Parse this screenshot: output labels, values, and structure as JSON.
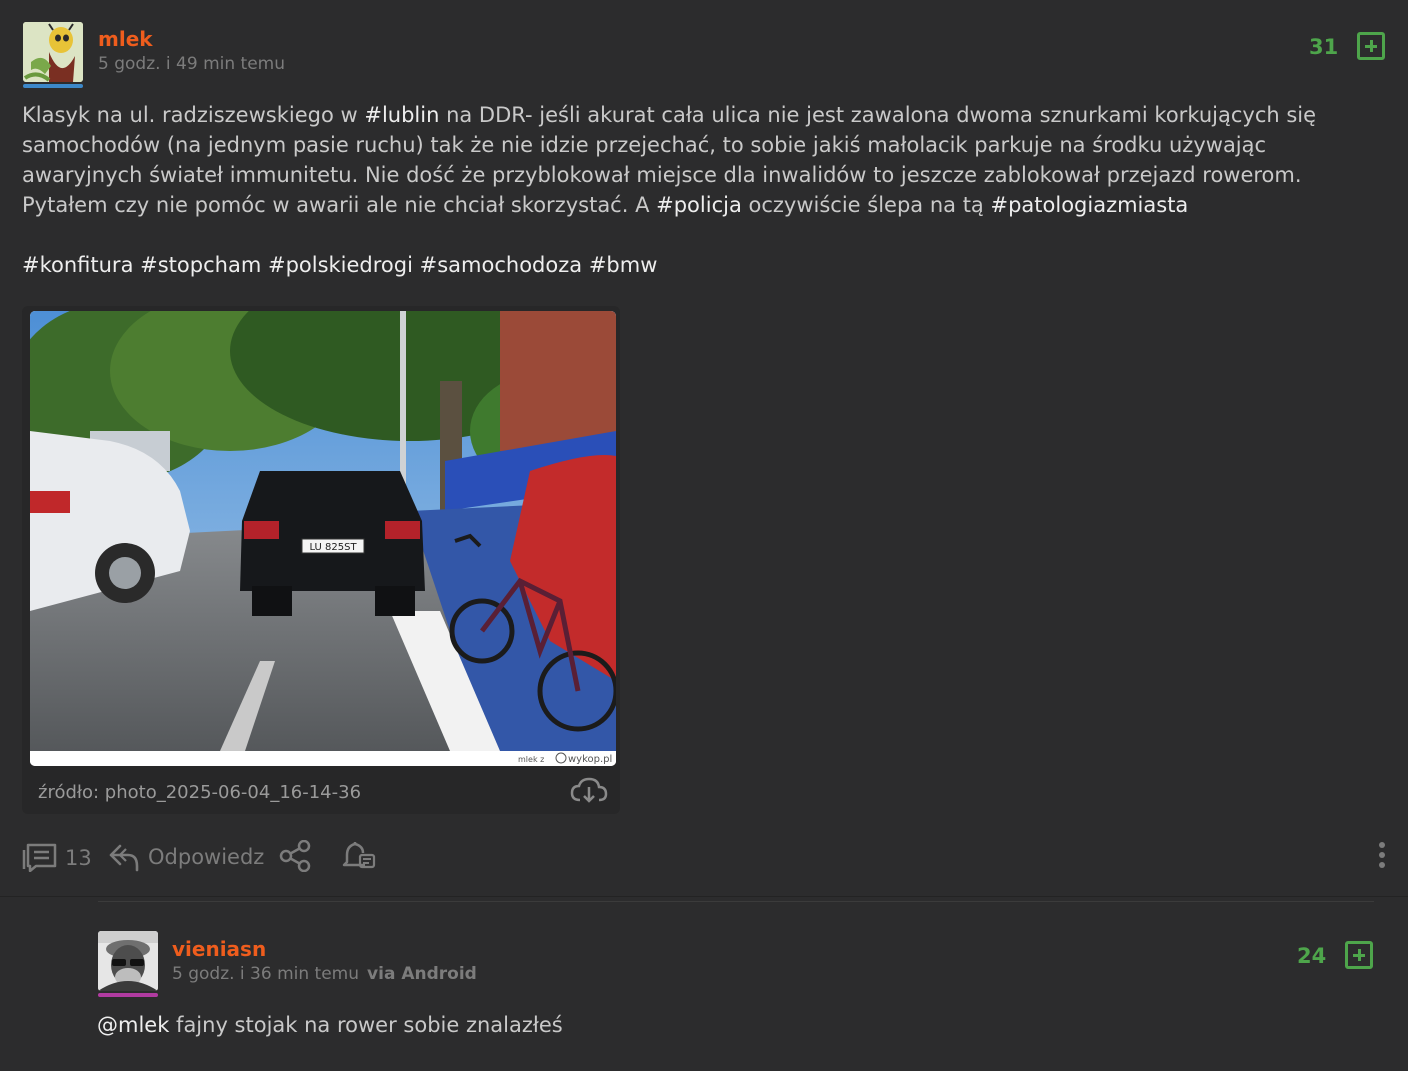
{
  "post": {
    "username": "mlek",
    "time": "5 godz. i 49 min temu",
    "votes": "31",
    "body": {
      "p1": "Klasyk na ul. radziszewskiego w ",
      "tag_lublin": "#lublin",
      "p2": " na DDR- jeśli akurat cała ulica nie jest zawalona dwoma sznurkami korkujących się samochodów (na jednym pasie ruchu) tak że nie idzie przejechać, to sobie jakiś małolacik parkuje na środku używając awaryjnych świateł immunitetu. Nie dość że przyblokował miejsce dla inwalidów to jeszcze zablokował przejazd rowerom. Pytałem czy nie pomóc w awarii ale nie chciał skorzystać. A ",
      "tag_policja": "#policja",
      "p3": " oczywiście ślepa na tą ",
      "tag_patologia": "#patologiazmiasta"
    },
    "tags": [
      "#konfitura",
      "#stopcham",
      "#polskiedrogi",
      "#samochodoza",
      "#bmw"
    ],
    "image": {
      "plate": "LU 825ST",
      "watermark_user": "mlek z",
      "watermark_site": "wykop.pl",
      "source": "źródło: photo_2025-06-04_16-14-36"
    },
    "actions": {
      "comments_count": "13",
      "reply_label": "Odpowiedz"
    }
  },
  "comment": {
    "username": "vieniasn",
    "time": "5 godz. i 36 min temu",
    "via": "via Android",
    "votes": "24",
    "mention": "@mlek",
    "text": " fajny stojak na rower sobie znalazłeś"
  },
  "colors": {
    "background": "#2c2c2d",
    "username": "#ef5d1d",
    "vote_green": "#4ea54b",
    "muted": "#7c7c7c",
    "text": "#c9c9c9"
  }
}
